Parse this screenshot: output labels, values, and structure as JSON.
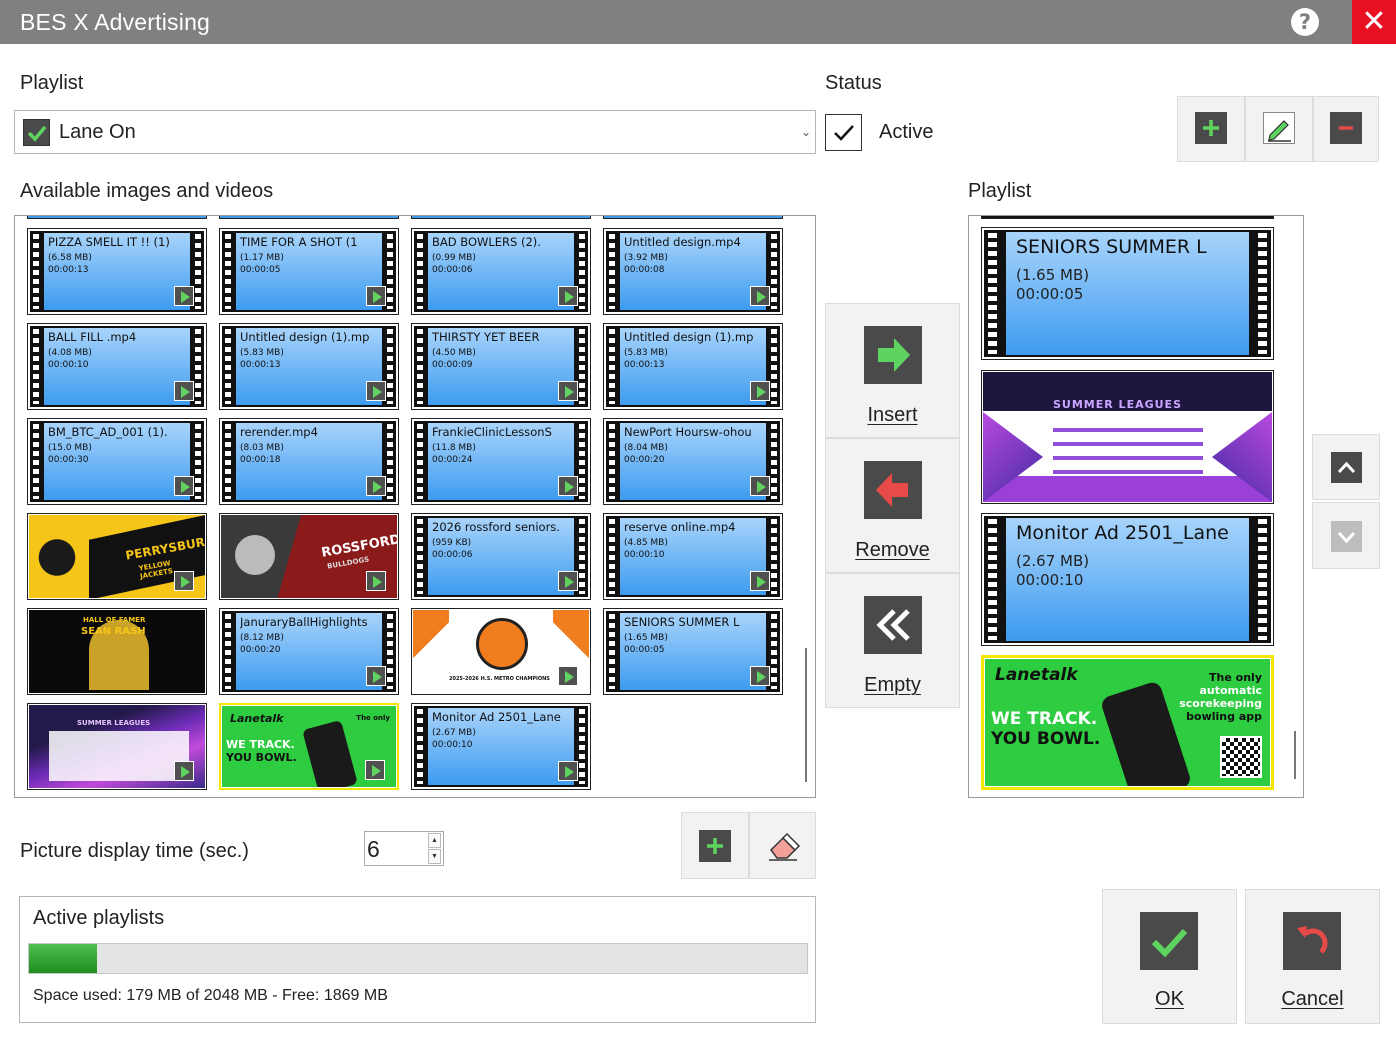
{
  "window": {
    "title": "BES X Advertising",
    "help_icon": "?",
    "close_icon": "✕"
  },
  "playlist_label": "Playlist",
  "playlist_value": "Lane On",
  "status_label": "Status",
  "status_active_label": "Active",
  "status_active_checked": true,
  "available_label": "Available images and videos",
  "right_playlist_label": "Playlist",
  "available_items": [
    {
      "name": "PIZZA SMELL IT  !! (1)",
      "size": "(6.58 MB)",
      "duration": "00:00:13"
    },
    {
      "name": "TIME FOR A SHOT  (1",
      "size": "(1.17 MB)",
      "duration": "00:00:05"
    },
    {
      "name": "BAD BOWLERS  (2).",
      "size": "(0.99 MB)",
      "duration": "00:00:06"
    },
    {
      "name": "Untitled design.mp4",
      "size": "(3.92 MB)",
      "duration": "00:00:08"
    },
    {
      "name": "BALL FILL .mp4",
      "size": "(4.08 MB)",
      "duration": "00:00:10"
    },
    {
      "name": "Untitled  design (1).mp",
      "size": "(5.83 MB)",
      "duration": "00:00:13"
    },
    {
      "name": "THIRSTY YET BEER",
      "size": "(4.50 MB)",
      "duration": "00:00:09"
    },
    {
      "name": "Untitled  design (1).mp",
      "size": "(5.83 MB)",
      "duration": "00:00:13"
    },
    {
      "name": "BM_BTC_AD_001 (1).",
      "size": "(15.0 MB)",
      "duration": "00:00:30"
    },
    {
      "name": "rerender.mp4",
      "size": "(8.03 MB)",
      "duration": "00:00:18"
    },
    {
      "name": "FrankieClinicLessonS",
      "size": "(11.8 MB)",
      "duration": "00:00:24"
    },
    {
      "name": "NewPort  Hoursw-ohou",
      "size": "(8.04 MB)",
      "duration": "00:00:20"
    },
    {
      "name": "2026  rossford seniors.",
      "size": "(959 KB)",
      "duration": "00:00:06"
    },
    {
      "name": "reserve online.mp4",
      "size": "(4.85 MB)",
      "duration": "00:00:10"
    },
    {
      "name": "JanuraryBallHighlights",
      "size": "(8.12 MB)",
      "duration": "00:00:20"
    },
    {
      "name": "SENIORS  SUMMER L",
      "size": "(1.65 MB)",
      "duration": "00:00:05"
    },
    {
      "name": "Monitor Ad 2501_Lane",
      "size": "(2.67 MB)",
      "duration": "00:00:10"
    }
  ],
  "image_texts": {
    "perrysburg": "PERRYSBURG",
    "perrysburg_sub": "YELLOW JACKETS",
    "rossford": "ROSSFORD",
    "rossford_sub": "BULLDOGS",
    "hall_of_fame": "HALL OF FAMER",
    "sean_rash": "SEAN RASH",
    "metro": "2025-2026 H.S. METRO CHAMPIONS",
    "summer_leagues": "SUMMER LEAGUES",
    "lanetalk": "Lanetalk",
    "lanetalk_slogan1": "WE TRACK.",
    "lanetalk_slogan2": "YOU BOWL.",
    "lanetalk_tag1": "The only",
    "lanetalk_tag2": "automatic",
    "lanetalk_tag3": "scorekeeping",
    "lanetalk_tag4": "bowling app"
  },
  "playlist_items": [
    {
      "name": "SENIORS  SUMMER L",
      "size": "(1.65 MB)",
      "duration": "00:00:05"
    },
    {
      "name": "Monitor  Ad 2501_Lane",
      "size": "(2.67 MB)",
      "duration": "00:00:10"
    }
  ],
  "buttons": {
    "insert": "Insert",
    "remove": "Remove",
    "empty": "Empty",
    "ok": "OK",
    "cancel": "Cancel"
  },
  "picture_time_label": "Picture display time (sec.)",
  "picture_time_value": "6",
  "active_playlists_label": "Active playlists",
  "space_used_text": "Space used: 179 MB of 2048 MB - Free: 1869 MB",
  "space_used_fraction": 0.087,
  "colors": {
    "accent_green": "#5fd35f",
    "close_red": "#e81123",
    "remove_red": "#e84a4a"
  }
}
